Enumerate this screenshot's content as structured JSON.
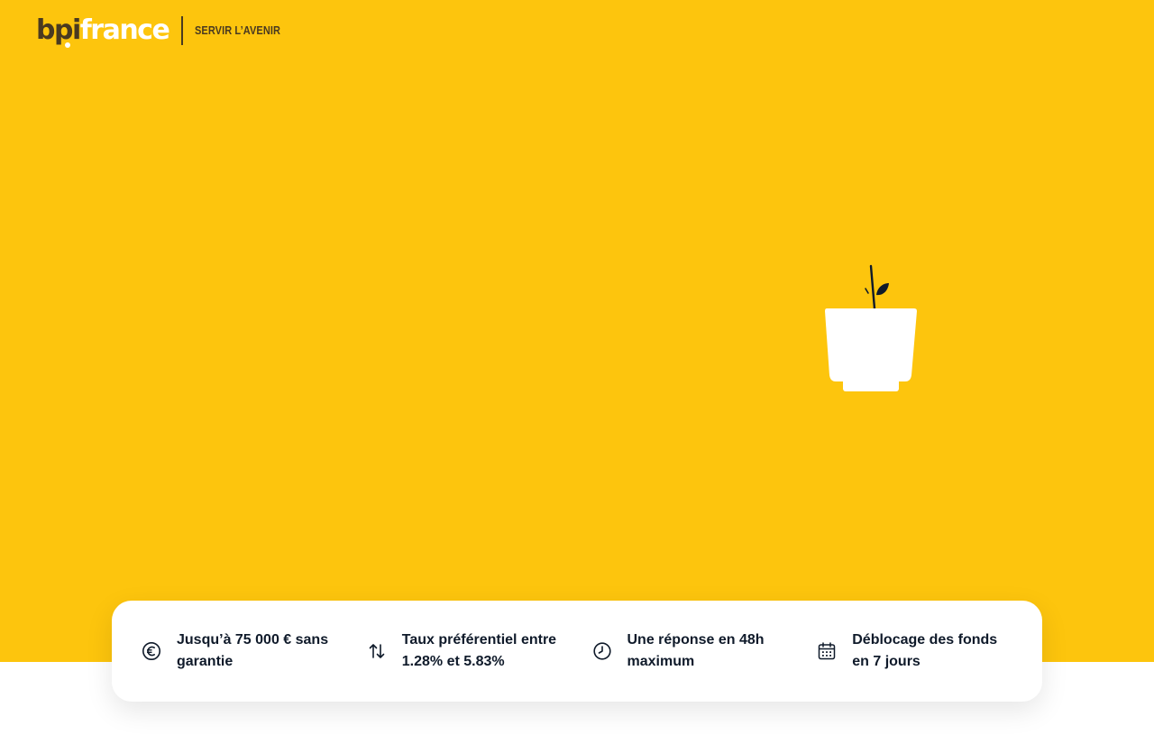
{
  "brand": {
    "logo_part1": "bpi",
    "logo_part2": "france",
    "tagline": "SERVIR L’AVENIR",
    "logo_color_dark": "#4A3A20",
    "background_color": "#FDC50D"
  },
  "hero": {
    "illustration": "plant-pot-illustration"
  },
  "features": [
    {
      "icon": "euro-icon",
      "text": "Jusqu’à 75 000 € sans garantie"
    },
    {
      "icon": "arrows-up-down-icon",
      "text": "Taux préférentiel entre 1.28% et 5.83%"
    },
    {
      "icon": "clock-icon",
      "text": "Une réponse en 48h maximum"
    },
    {
      "icon": "calendar-icon",
      "text": "Déblocage des fonds en 7 jours"
    }
  ]
}
